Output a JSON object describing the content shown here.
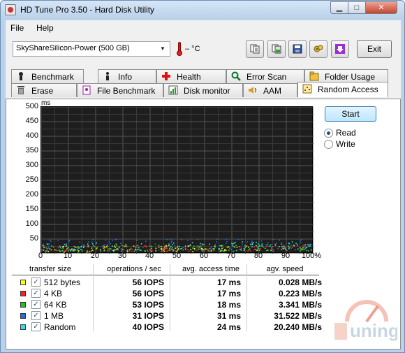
{
  "window": {
    "title": "HD Tune Pro 3.50 - Hard Disk Utility",
    "min_glyph": "▁",
    "max_glyph": "□",
    "close_glyph": "✕"
  },
  "menu": {
    "file_label": "File",
    "help_label": "Help"
  },
  "toolbar": {
    "drive_value": "SkyShareSilicon-Power (500 GB)",
    "temperature": "– °C",
    "buttons": [
      "copy-text-icon",
      "copy-screenshot-icon",
      "save-icon",
      "options-icon",
      "download-icon"
    ],
    "exit_label": "Exit"
  },
  "tabs": {
    "row1": [
      {
        "label": "Benchmark",
        "icon": "benchmark-icon"
      },
      {
        "label": "Info",
        "icon": "info-icon"
      },
      {
        "label": "Health",
        "icon": "health-icon"
      },
      {
        "label": "Error Scan",
        "icon": "error-scan-icon"
      },
      {
        "label": "Folder Usage",
        "icon": "folder-usage-icon"
      }
    ],
    "row2": [
      {
        "label": "Erase",
        "icon": "erase-icon"
      },
      {
        "label": "File Benchmark",
        "icon": "file-benchmark-icon"
      },
      {
        "label": "Disk monitor",
        "icon": "disk-monitor-icon"
      },
      {
        "label": "AAM",
        "icon": "aam-icon"
      },
      {
        "label": "Random Access",
        "icon": "random-access-icon",
        "active": true
      }
    ]
  },
  "controls": {
    "start_label": "Start",
    "read_label": "Read",
    "write_label": "Write",
    "selected": "Read"
  },
  "chart_data": {
    "type": "scatter",
    "ylabel": "ms",
    "ylim": [
      0,
      500
    ],
    "yticks": [
      "500",
      "450",
      "400",
      "350",
      "300",
      "250",
      "200",
      "150",
      "100",
      "50"
    ],
    "xlim": [
      0,
      100
    ],
    "xticks": [
      "0",
      "10",
      "20",
      "30",
      "40",
      "50",
      "60",
      "70",
      "80",
      "90",
      "100%"
    ],
    "grid": true,
    "background": "#1e1e1e",
    "series": [
      {
        "name": "512 bytes",
        "color": "#ffff00",
        "typical_ms": 17
      },
      {
        "name": "4 KB",
        "color": "#ff3030",
        "typical_ms": 17
      },
      {
        "name": "64 KB",
        "color": "#30e030",
        "typical_ms": 18
      },
      {
        "name": "1 MB",
        "color": "#1e6fe0",
        "typical_ms": 31
      },
      {
        "name": "Random",
        "color": "#30e0e0",
        "typical_ms": 24
      }
    ]
  },
  "table": {
    "headers": [
      "transfer size",
      "operations / sec",
      "avg. access time",
      "agv. speed"
    ],
    "rows": [
      {
        "name": "512 bytes",
        "color": "#ffff00",
        "ops": "56 IOPS",
        "access": "17 ms",
        "speed": "0.028 MB/s"
      },
      {
        "name": "4 KB",
        "color": "#ff2020",
        "ops": "56 IOPS",
        "access": "17 ms",
        "speed": "0.223 MB/s"
      },
      {
        "name": "64 KB",
        "color": "#20c020",
        "ops": "53 IOPS",
        "access": "18 ms",
        "speed": "3.341 MB/s"
      },
      {
        "name": "1 MB",
        "color": "#1e6fe0",
        "ops": "31 IOPS",
        "access": "31 ms",
        "speed": "31.522 MB/s"
      },
      {
        "name": "Random",
        "color": "#30e0e0",
        "ops": "40 IOPS",
        "access": "24 ms",
        "speed": "20.240 MB/s"
      }
    ]
  },
  "watermark": {
    "text": "uning"
  }
}
